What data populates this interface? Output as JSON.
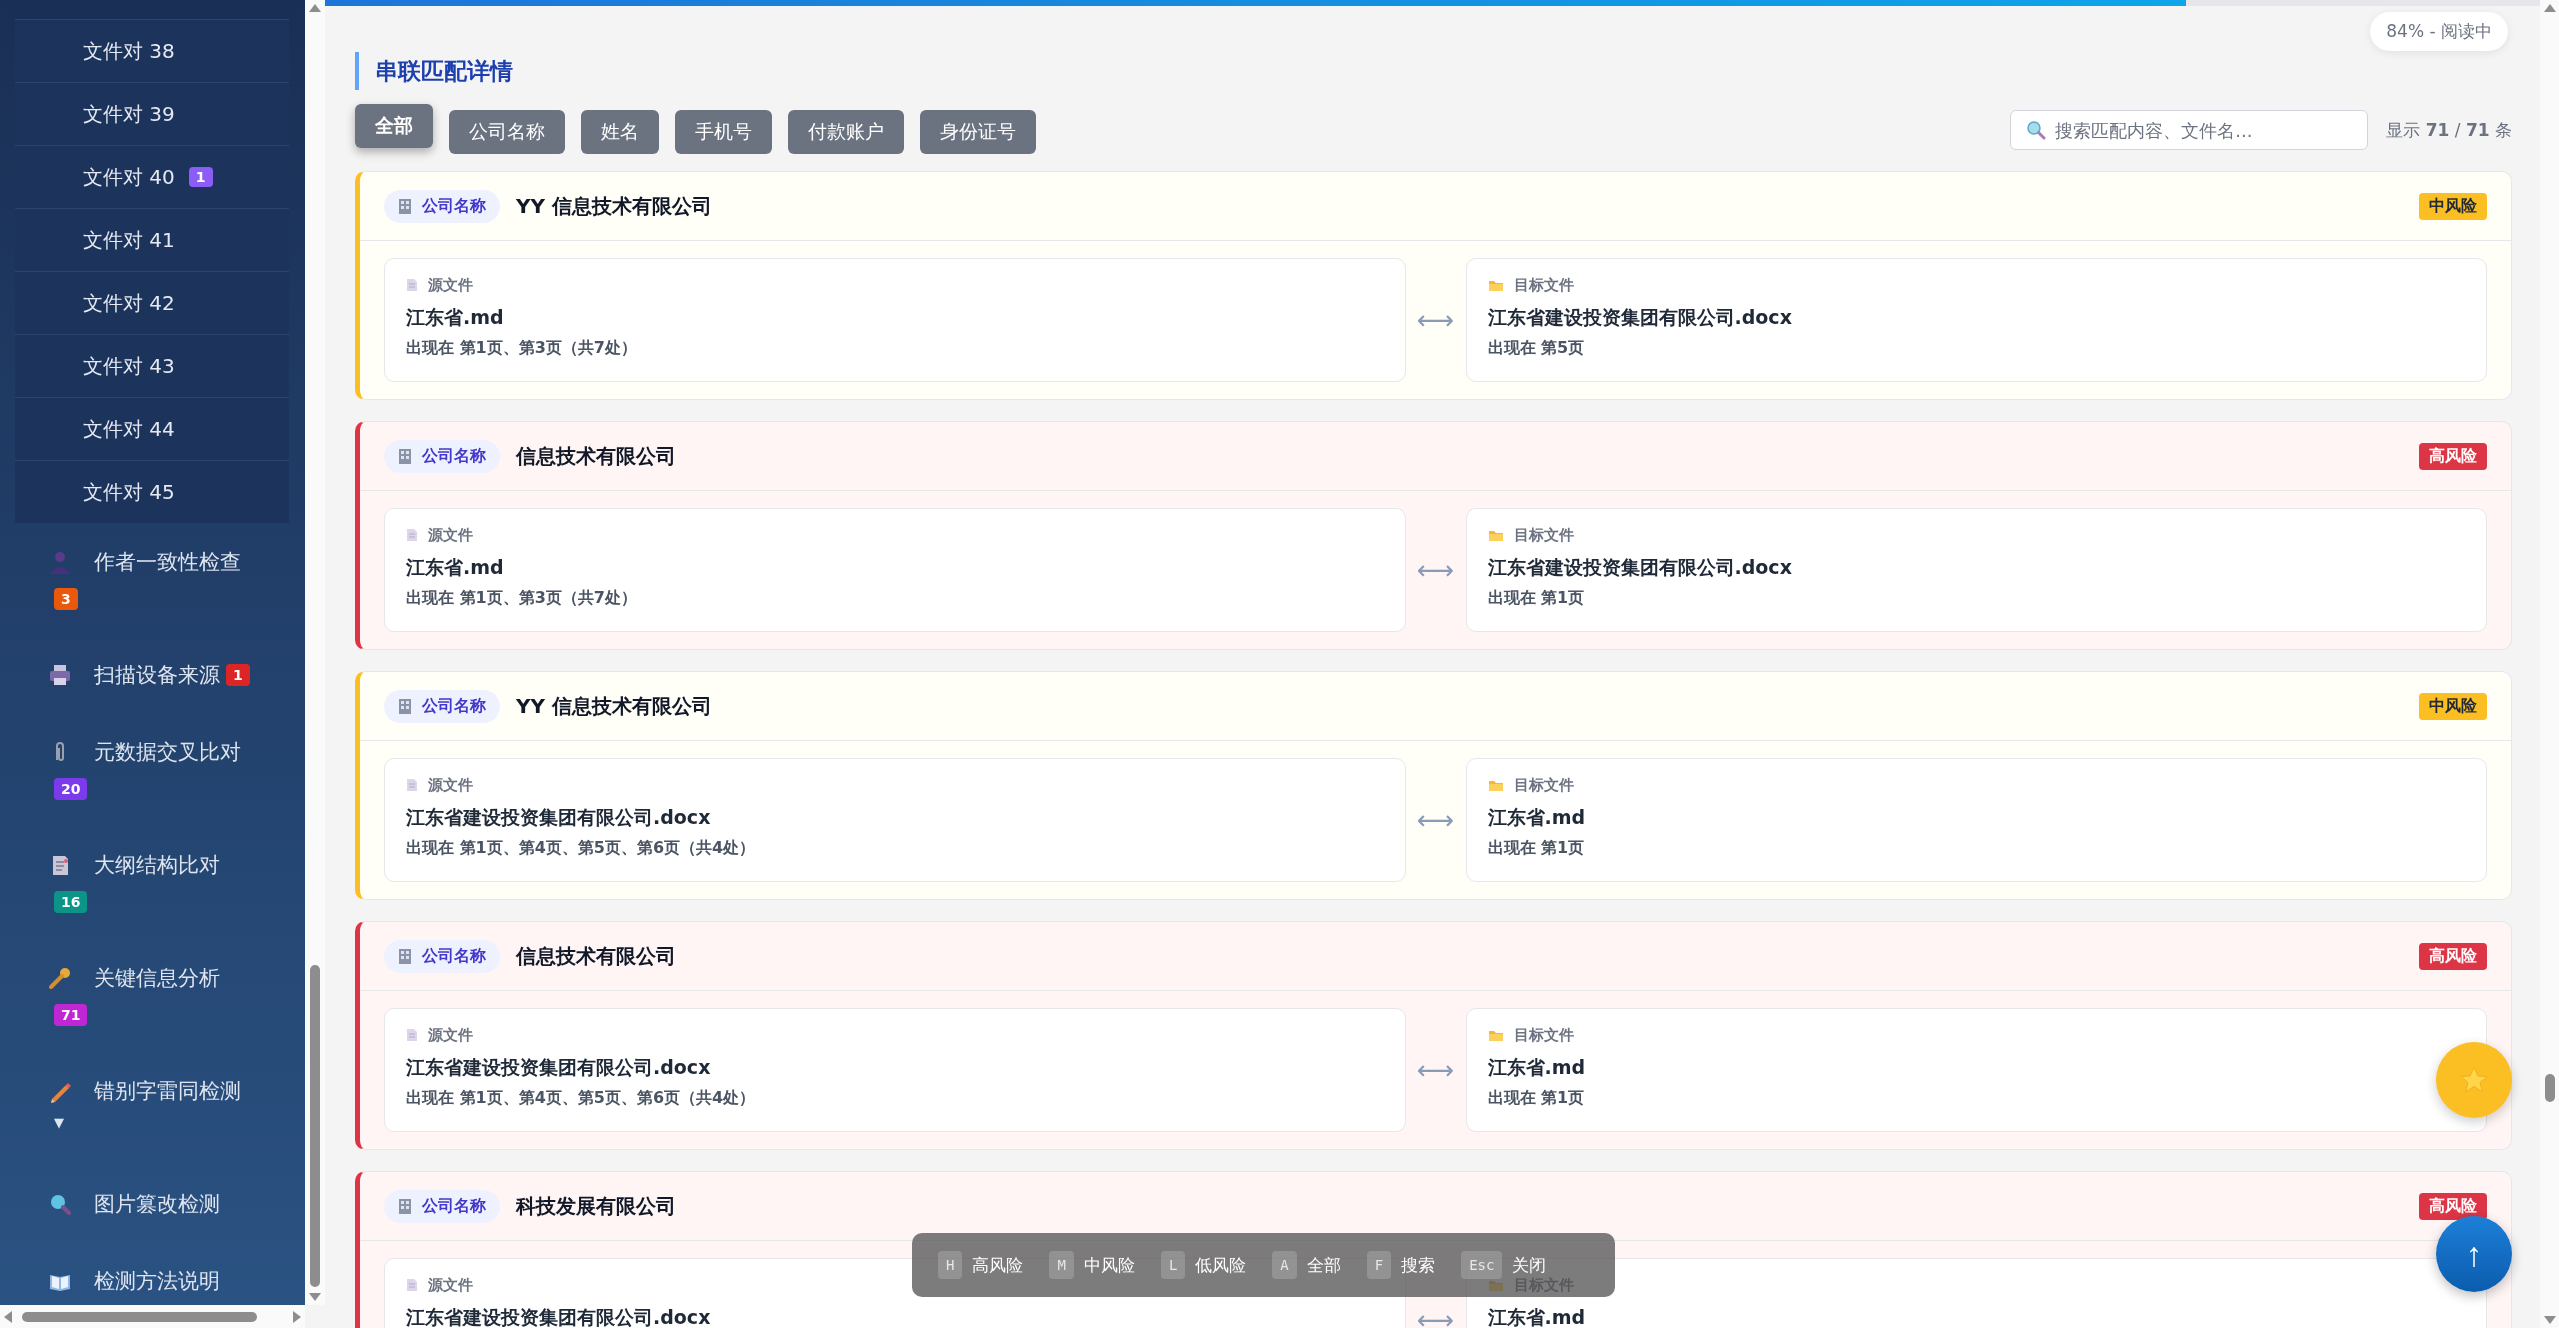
{
  "sidebar": {
    "pairs": [
      {
        "label": "文件对 38"
      },
      {
        "label": "文件对 39"
      },
      {
        "label": "文件对 40",
        "badge": "1"
      },
      {
        "label": "文件对 41"
      },
      {
        "label": "文件对 42"
      },
      {
        "label": "文件对 43"
      },
      {
        "label": "文件对 44"
      },
      {
        "label": "文件对 45"
      }
    ],
    "nav_items": [
      {
        "label": "作者一致性检查",
        "badge": "3",
        "color": "#ea580c"
      },
      {
        "label": "扫描设备来源",
        "badge": "1",
        "color": "#dc2626"
      },
      {
        "label": "元数据交叉比对",
        "badge": "20",
        "color": "#7c3aed"
      },
      {
        "label": "大纲结构比对",
        "badge": "16",
        "color": "#0d9488"
      },
      {
        "label": "关键信息分析",
        "badge": "71",
        "color": "#c026d3"
      },
      {
        "label": "错别字雷同检测",
        "caret": "▼"
      },
      {
        "label": "图片篡改检测"
      },
      {
        "label": "检测方法说明"
      }
    ]
  },
  "reading": {
    "level": 0.84,
    "status": "84% - 阅读中"
  },
  "title": "串联匹配详情",
  "filters": [
    {
      "label": "全部",
      "selected": true
    },
    {
      "label": "公司名称",
      "selected": false
    },
    {
      "label": "姓名",
      "selected": false
    },
    {
      "label": "手机号",
      "selected": false
    },
    {
      "label": "付款账户",
      "selected": false
    },
    {
      "label": "身份证号",
      "selected": false
    }
  ],
  "search": {
    "placeholder": "搜索匹配内容、文件名..."
  },
  "count": "显示 **71** / **71** 条",
  "cards": [
    {
      "tag": "公司名称",
      "value": "YY 信息技术有限公司",
      "kind": "medium",
      "risk_label": "中风险",
      "arrow": "⟷",
      "source": {
        "label": "源文件",
        "name": "江东省.md",
        "occurrence": "出现在 第1页、第3页（共7处）"
      },
      "target": {
        "label": "目标文件",
        "name": "江东省建设投资集团有限公司.docx",
        "occurrence": "出现在 第5页"
      }
    },
    {
      "tag": "公司名称",
      "value": "信息技术有限公司",
      "kind": "high",
      "risk_label": "高风险",
      "arrow": "⟷",
      "source": {
        "label": "源文件",
        "name": "江东省.md",
        "occurrence": "出现在 第1页、第3页（共7处）"
      },
      "target": {
        "label": "目标文件",
        "name": "江东省建设投资集团有限公司.docx",
        "occurrence": "出现在 第1页"
      }
    },
    {
      "tag": "公司名称",
      "value": "YY 信息技术有限公司",
      "kind": "medium",
      "risk_label": "中风险",
      "arrow": "⟷",
      "source": {
        "label": "源文件",
        "name": "江东省建设投资集团有限公司.docx",
        "occurrence": "出现在 第1页、第4页、第5页、第6页（共4处）"
      },
      "target": {
        "label": "目标文件",
        "name": "江东省.md",
        "occurrence": "出现在 第1页"
      }
    },
    {
      "tag": "公司名称",
      "value": "信息技术有限公司",
      "kind": "high",
      "risk_label": "高风险",
      "arrow": "⟷",
      "source": {
        "label": "源文件",
        "name": "江东省建设投资集团有限公司.docx",
        "occurrence": "出现在 第1页、第4页、第5页、第6页（共4处）"
      },
      "target": {
        "label": "目标文件",
        "name": "江东省.md",
        "occurrence": "出现在 第1页"
      }
    },
    {
      "tag": "公司名称",
      "value": "科技发展有限公司",
      "kind": "high",
      "risk_label": "高风险",
      "arrow": "⟷",
      "source": {
        "label": "源文件",
        "name": "江东省建设投资集团有限公司.docx"
      },
      "target": {
        "label": "目标文件",
        "name": "江东省.md"
      }
    }
  ],
  "shortcuts": [
    {
      "key": "H",
      "label": "高风险"
    },
    {
      "key": "M",
      "label": "中风险"
    },
    {
      "key": "L",
      "label": "低风险"
    },
    {
      "key": "A",
      "label": "全部"
    },
    {
      "key": "F",
      "label": "搜索"
    },
    {
      "key": "Esc",
      "label": "关闭"
    }
  ],
  "back_to_top": "↑"
}
